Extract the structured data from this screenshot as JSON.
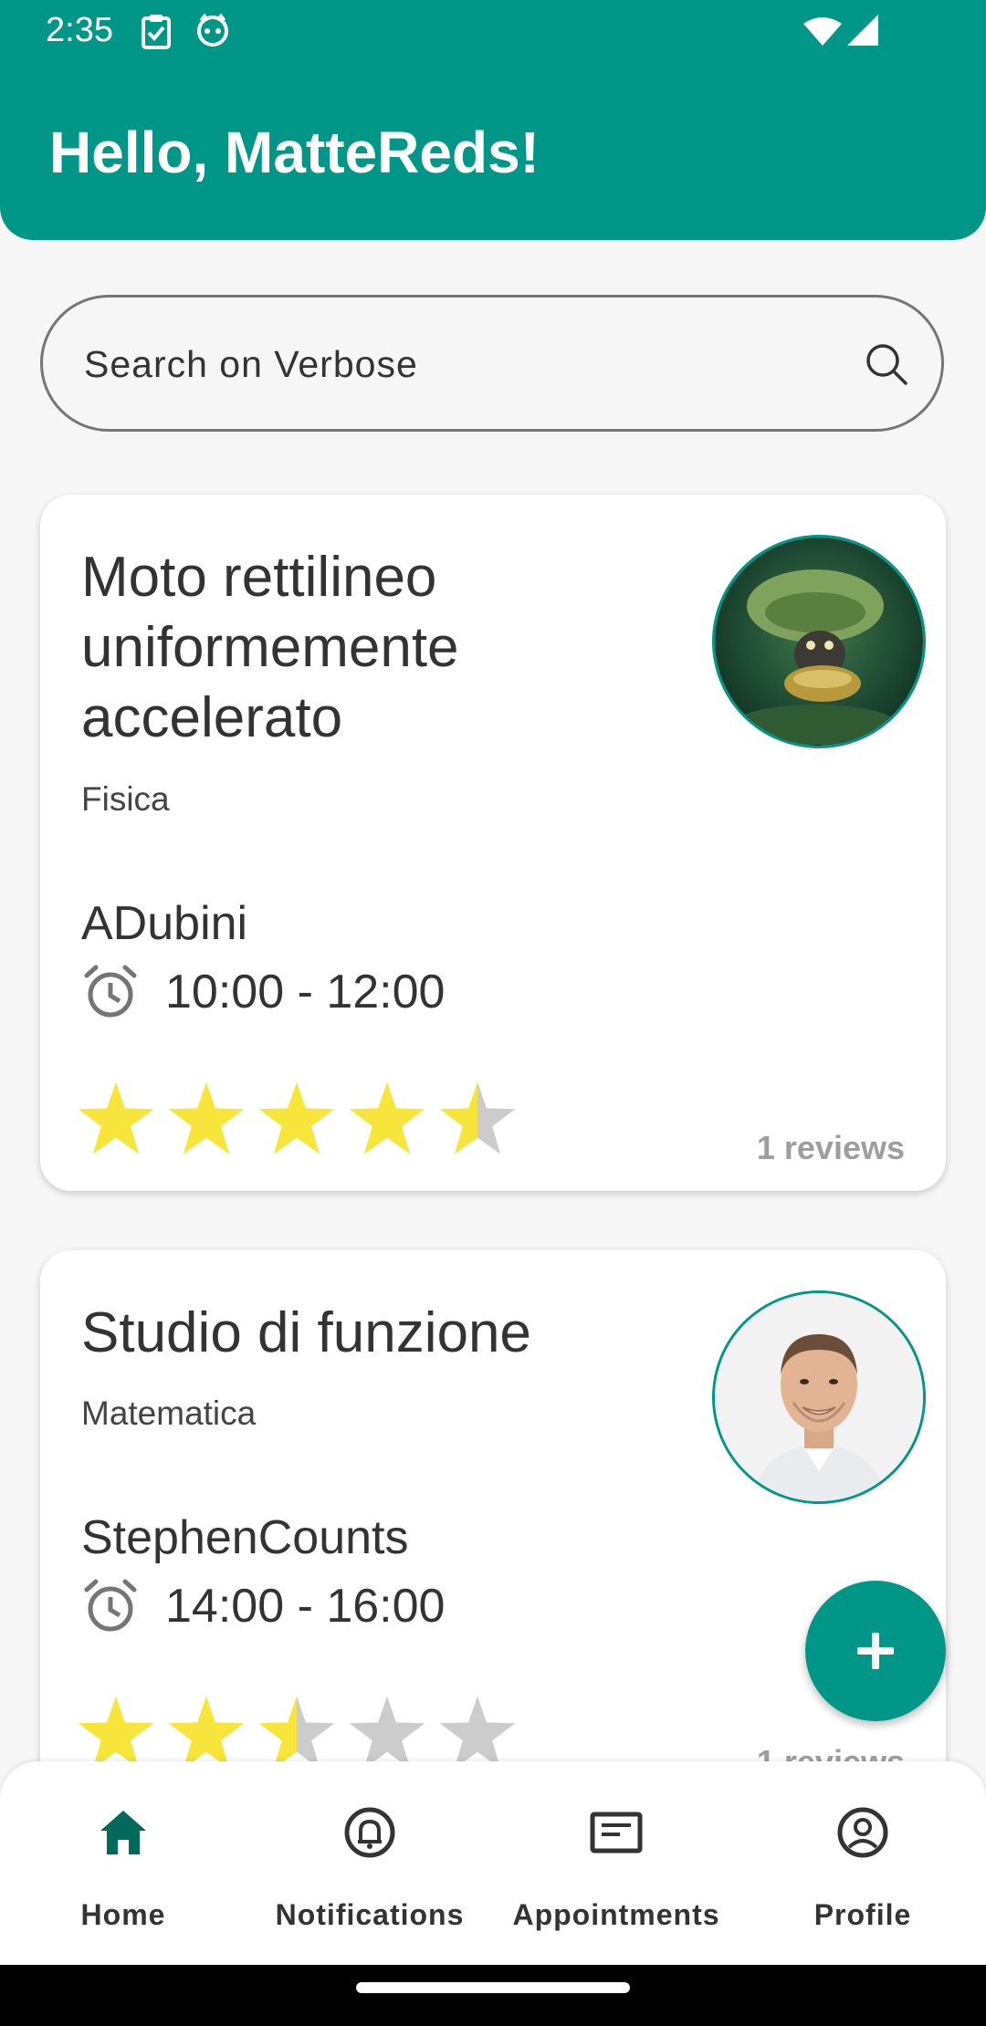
{
  "status_bar": {
    "time": "2:35"
  },
  "header": {
    "greeting": "Hello, MatteReds!"
  },
  "search": {
    "placeholder": "Search on Verbose"
  },
  "colors": {
    "primary": "#009688",
    "star_filled": "#F7E53B",
    "star_empty": "#CCCCCC",
    "reviews_text": "#9E9E9E"
  },
  "lessons": [
    {
      "title": "Moto rettilineo uniformemente accelerato",
      "subject": "Fisica",
      "author": "ADubini",
      "time": "10:00 - 12:00",
      "rating": 4.5,
      "reviews": "1 reviews"
    },
    {
      "title": "Studio di funzione",
      "subject": "Matematica",
      "author": "StephenCounts",
      "time": "14:00 - 16:00",
      "rating": 2.5,
      "reviews": "1 reviews"
    }
  ],
  "bottom_nav": {
    "items": [
      {
        "label": "Home",
        "icon": "home-icon",
        "active": true
      },
      {
        "label": "Notifications",
        "icon": "bell-icon",
        "active": false
      },
      {
        "label": "Appointments",
        "icon": "message-icon",
        "active": false
      },
      {
        "label": "Profile",
        "icon": "account-circle-icon",
        "active": false
      }
    ]
  }
}
